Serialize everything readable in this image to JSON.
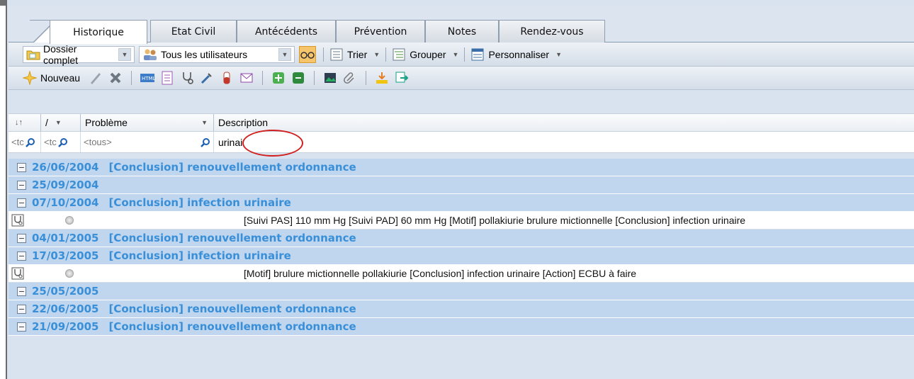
{
  "tabs": [
    {
      "label": "Historique",
      "active": true
    },
    {
      "label": "Etat Civil",
      "active": false
    },
    {
      "label": "Antécédents",
      "active": false
    },
    {
      "label": "Prévention",
      "active": false
    },
    {
      "label": "Notes",
      "active": false
    },
    {
      "label": "Rendez-vous",
      "active": false
    }
  ],
  "toolbar1": {
    "dossier_select": "Dossier complet",
    "users_select": "Tous les utilisateurs",
    "trier_label": "Trier",
    "grouper_label": "Grouper",
    "personnaliser_label": "Personnaliser"
  },
  "toolbar2": {
    "nouveau_label": "Nouveau"
  },
  "grid": {
    "columns": {
      "col1": "",
      "col2": "/",
      "probleme": "Problème",
      "description": "Description"
    },
    "filters": {
      "f1": "<tc",
      "f2": "<tc",
      "probleme": "<tous>",
      "description": "urinai"
    },
    "rows": [
      {
        "type": "group",
        "date": "26/06/2004",
        "text": "[Conclusion] renouvellement ordonnance"
      },
      {
        "type": "group",
        "date": "25/09/2004",
        "text": ""
      },
      {
        "type": "group",
        "date": "07/10/2004",
        "text": "[Conclusion] infection urinaire"
      },
      {
        "type": "detail",
        "text": "[Suivi PAS] 110 mm Hg [Suivi PAD] 60 mm Hg [Motif] pollakiurie  brulure mictionnelle   [Conclusion] infection urinaire"
      },
      {
        "type": "group",
        "date": "04/01/2005",
        "text": "[Conclusion] renouvellement ordonnance"
      },
      {
        "type": "group",
        "date": "17/03/2005",
        "text": "[Conclusion] infection urinaire"
      },
      {
        "type": "detail",
        "text": "[Motif] brulure mictionnelle  pollakiurie   [Conclusion] infection urinaire   [Action] ECBU à faire"
      },
      {
        "type": "group",
        "date": "25/05/2005",
        "text": ""
      },
      {
        "type": "group",
        "date": "22/06/2005",
        "text": "[Conclusion] renouvellement ordonnance"
      },
      {
        "type": "group",
        "date": "21/09/2005",
        "text": "[Conclusion] renouvellement ordonnance"
      }
    ]
  },
  "colors": {
    "group_row_bg": "#bfd6ee",
    "group_text": "#3a8fd9",
    "highlight_circle": "#d12020"
  }
}
